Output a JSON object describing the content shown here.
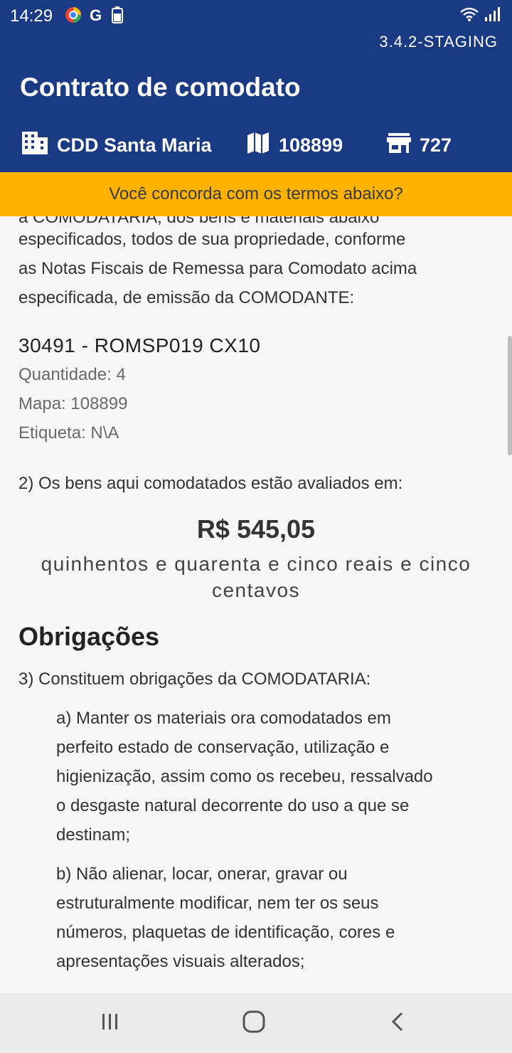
{
  "status_bar": {
    "time": "14:29",
    "icons_left": [
      "browser-icon",
      "google-icon",
      "battery-saver-icon"
    ],
    "icons_right": [
      "wifi-icon",
      "signal-icon"
    ]
  },
  "header": {
    "version": "3.4.2-STAGING",
    "title": "Contrato de comodato",
    "info": {
      "location": "CDD Santa Maria",
      "map_number": "108899",
      "store_number": "727"
    },
    "color": "#1a3a84"
  },
  "banner": {
    "text": "Você concorda com os termos abaixo?",
    "color": "#ffb300"
  },
  "contract": {
    "cut_line": "a COMODATARIA, dos  bens  e materiais abaixo",
    "intro_lines": [
      "especificados, todos de sua propriedade, conforme",
      "as Notas Fiscais de Remessa para Comodato acima",
      "especificada, de emissão da COMODANTE:"
    ],
    "item": {
      "title": "30491 - ROMSP019 CX10",
      "quantity": "Quantidade: 4",
      "map": "Mapa: 108899",
      "label": "Etiqueta: N\\A"
    },
    "clause_2": "2) Os bens aqui comodatados estão avaliados em:",
    "price": "R$ 545,05",
    "price_words_line1": "quinhentos e quarenta e cinco reais e cinco",
    "price_words_line2": "centavos",
    "section_title": "Obrigações",
    "clause_3": "3) Constituem obrigações da COMODATARIA:",
    "sub_a_lines": [
      "a) Manter os materiais ora comodatados em",
      "perfeito estado de conservação, utilização e",
      "higienização, assim  como  os recebeu, ressalvado",
      "o desgaste natural decorrente do uso a que se",
      "destinam;"
    ],
    "sub_b_lines": [
      "b) Não alienar, locar, onerar, gravar ou",
      "estruturalmente modificar, nem ter os seus",
      "números, plaquetas de identificação, cores e",
      "apresentações visuais alterados;"
    ]
  },
  "nav_bar": {
    "buttons": [
      "recent-apps-icon",
      "home-icon",
      "back-icon"
    ]
  }
}
